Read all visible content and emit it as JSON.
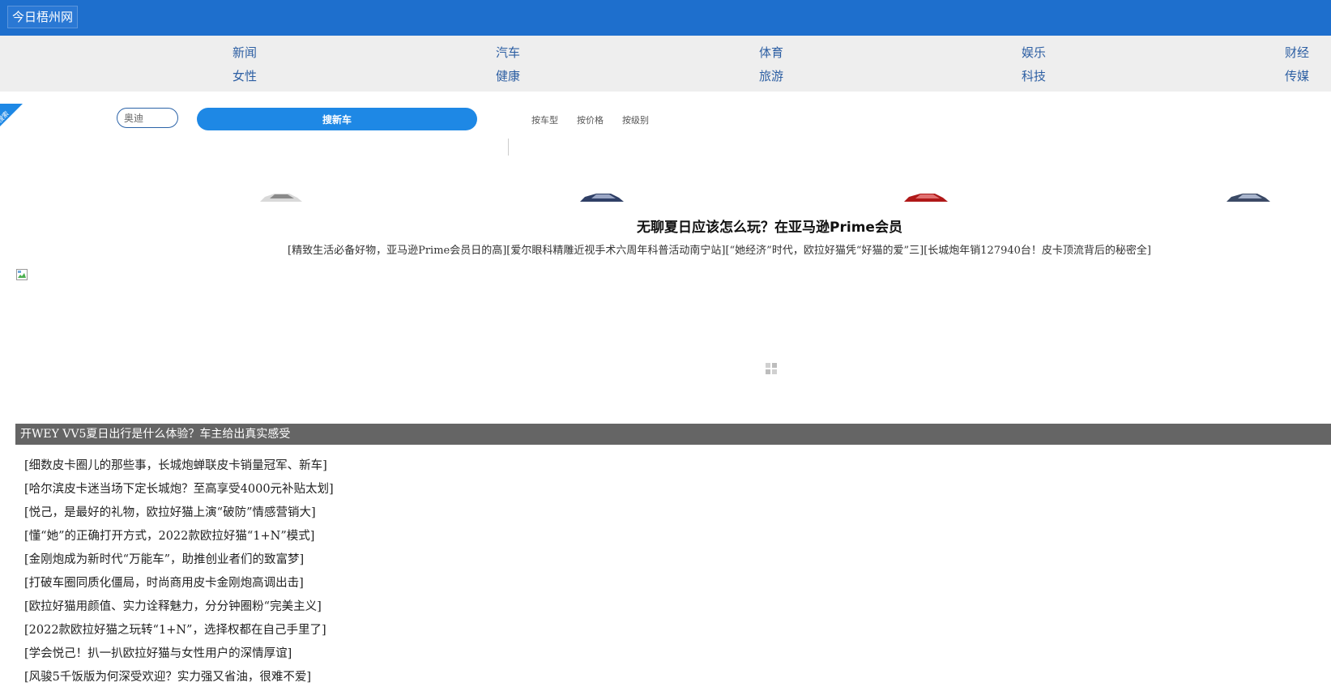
{
  "header": {
    "logo": "今日梧州网"
  },
  "nav": {
    "row1": [
      "新闻",
      "汽车",
      "体育",
      "娱乐",
      "财经"
    ],
    "row2": [
      "女性",
      "健康",
      "旅游",
      "科技",
      "传媒"
    ]
  },
  "search": {
    "ribbon_label": "搜索",
    "input_value": "奥迪",
    "button_label": "搜新车",
    "filters": [
      "按车型",
      "按价格",
      "按级别"
    ]
  },
  "headline": "无聊夏日应该怎么玩？在亚马逊Prime会员",
  "related_links": [
    "[精致生活必备好物，亚马逊Prime会员日的高]",
    "[爱尔眼科精雕近视手术六周年科普活动南宁站]",
    "[“她经济”时代，欧拉好猫凭“好猫的爱”三]",
    "[长城炮年销127940台！皮卡顶流背后的秘密全]"
  ],
  "feature_bar": "开WEY VV5夏日出行是什么体验？车主给出真实感受",
  "article_list": [
    "[细数皮卡圈儿的那些事，长城炮蝉联皮卡销量冠军、新车]",
    "[哈尔滨皮卡迷当场下定长城炮？至高享受4000元补贴太划]",
    "[悦己，是最好的礼物，欧拉好猫上演“破防”情感营销大]",
    "[懂“她”的正确打开方式，2022款欧拉好猫“1+N”模式]",
    "[金刚炮成为新时代“万能车”，助推创业者们的致富梦]",
    "[打破车圈同质化僵局，时尚商用皮卡金刚炮高调出击]",
    "[欧拉好猫用颜值、实力诠释魅力，分分钟圈粉“完美主义]",
    "[2022款欧拉好猫之玩转“1+N”，选择权都在自己手里了]",
    "[学会悦己！扒一扒欧拉好猫与女性用户的深情厚谊]",
    "[风骏5千饭版为何深受欢迎？实力强又省油，很难不爱]"
  ],
  "colors": {
    "topbar": "#1e6fcd",
    "nav_bg": "#eeeeee",
    "nav_link": "#2d5fa3",
    "search_button": "#1e88e5",
    "feature_bar": "#656565"
  }
}
